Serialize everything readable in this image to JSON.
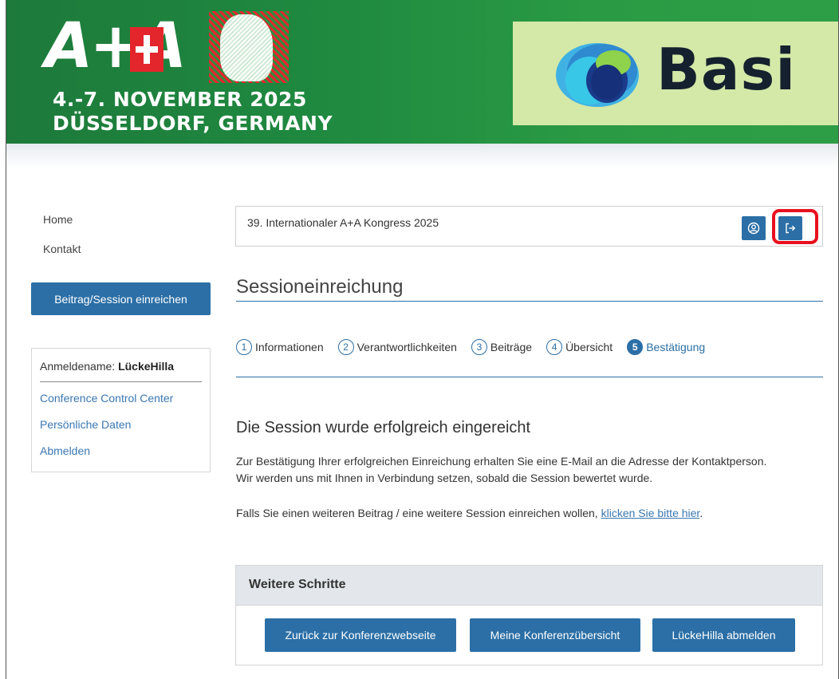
{
  "header": {
    "event_logo_text": "A+A",
    "event_date": "4.-7. NOVEMBER 2025",
    "event_location": "DÜSSELDORF, GERMANY",
    "sponsor_name": "Basi"
  },
  "sidebar": {
    "links": [
      {
        "label": "Home"
      },
      {
        "label": "Kontakt"
      }
    ],
    "submit_button": "Beitrag/Session einreichen",
    "login": {
      "name_label": "Anmeldename:",
      "username": "LückeHilla",
      "links": [
        {
          "label": "Conference Control Center"
        },
        {
          "label": "Persönliche Daten"
        },
        {
          "label": "Abmelden"
        }
      ]
    }
  },
  "main": {
    "conference_title": "39. Internationaler A+A Kongress 2025",
    "page_title": "Sessioneinreichung",
    "steps": [
      {
        "num": "1",
        "label": "Informationen"
      },
      {
        "num": "2",
        "label": "Verantwortlichkeiten"
      },
      {
        "num": "3",
        "label": "Beiträge"
      },
      {
        "num": "4",
        "label": "Übersicht"
      },
      {
        "num": "5",
        "label": "Bestätigung"
      }
    ],
    "success_heading": "Die Session wurde erfolgreich eingereicht",
    "confirmation_line1": "Zur Bestätigung Ihrer erfolgreichen Einreichung erhalten Sie eine E-Mail an die Adresse der Kontaktperson.",
    "confirmation_line2": "Wir werden uns mit Ihnen in Verbindung setzen, sobald die Session bewertet wurde.",
    "further_text": "Falls Sie einen weiteren Beitrag / eine weitere Session einreichen wollen, ",
    "further_link": "klicken Sie bitte hier",
    "further_suffix": ".",
    "next_steps": {
      "title": "Weitere Schritte",
      "buttons": [
        {
          "label": "Zurück zur Konferenzwebseite"
        },
        {
          "label": "Meine Konferenzübersicht"
        },
        {
          "label": "LückeHilla abmelden"
        }
      ]
    }
  },
  "colors": {
    "primary_blue": "#2b6fa6",
    "banner_green": "#1f8a40",
    "highlight_red": "#e8101e",
    "sponsor_bg": "#d4e8a8"
  },
  "icons": {
    "profile": "user-circle-icon",
    "logout": "logout-icon"
  }
}
